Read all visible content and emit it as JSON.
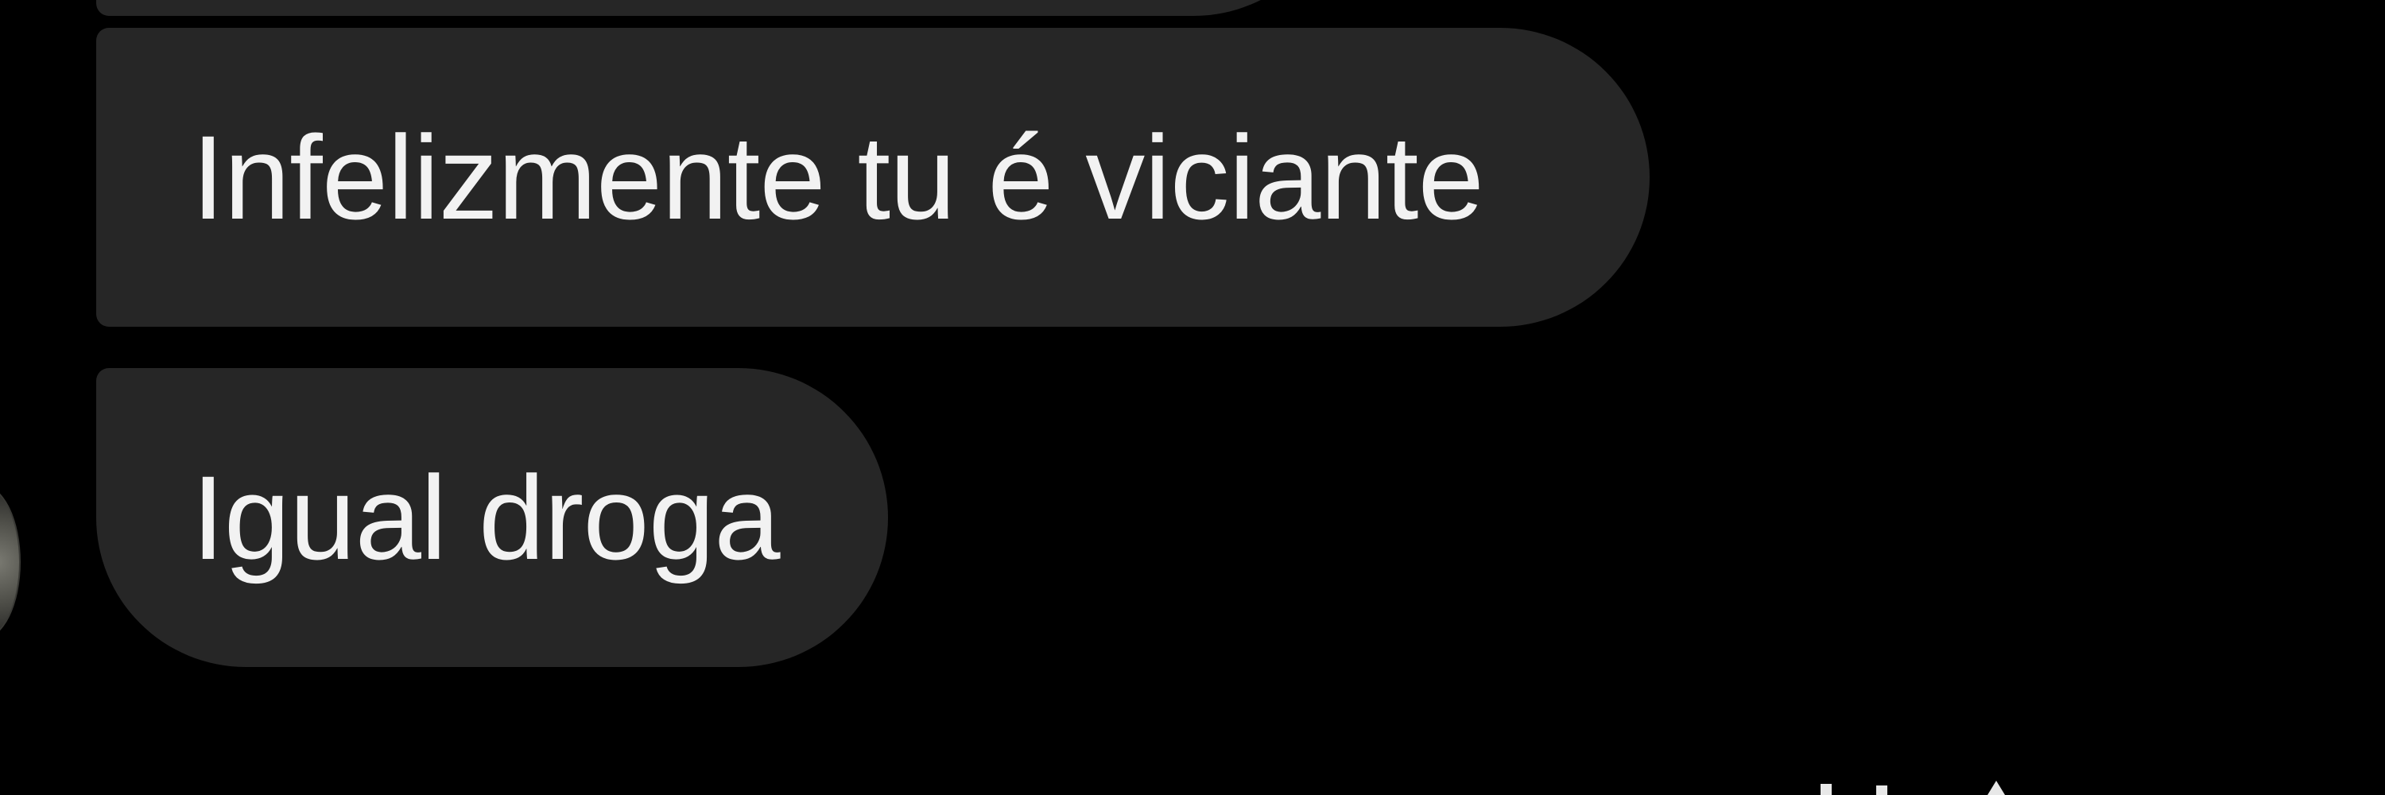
{
  "messages": [
    {
      "text": "Infelizmente tu é viciante"
    },
    {
      "text": "Igual droga"
    }
  ],
  "colors": {
    "background": "#000000",
    "bubble": "#262626",
    "text": "#f2f2f2"
  }
}
